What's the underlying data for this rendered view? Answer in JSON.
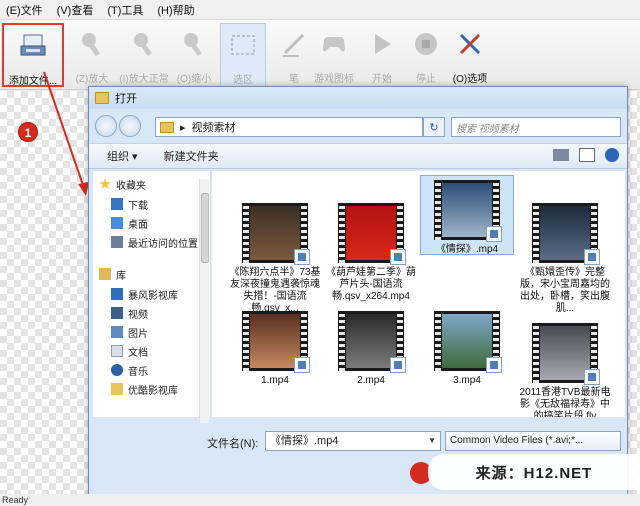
{
  "menubar": {
    "items": [
      "(E)文件",
      "(V)查看",
      "(T)工具",
      "(H)帮助"
    ]
  },
  "toolbar": {
    "add_file_label": "添加文件...",
    "zoom_in_label": "(Z)放大",
    "zoom_fit_label": "(I)放大正常",
    "zoom_out_label": "(O)缩小",
    "select_label": "选区",
    "pen_label": "笔",
    "controller_label": "游戏图标",
    "start_label": "开始",
    "stop_label": "停止",
    "options_label": "(O)选项"
  },
  "callout": {
    "number": "1"
  },
  "dialog": {
    "title": "打开",
    "address": "视频素材",
    "search_placeholder": "搜索 视频素材",
    "cmd_organize": "组织 ▾",
    "cmd_new_folder": "新建文件夹",
    "nav": {
      "favorites": "收藏夹",
      "downloads": "下载",
      "desktop": "桌面",
      "recent": "最近访问的位置",
      "library": "库",
      "baofeng": "暴风影视库",
      "videos": "视频",
      "pictures": "图片",
      "documents": "文档",
      "music": "音乐",
      "youku": "优酷影视库"
    },
    "files": [
      {
        "name": "《陈翔六点半》73基友深夜撞鬼遇袭惊魂失措！-国语流畅.qsv_x..."
      },
      {
        "name": "《葫芦娃第二季》葫芦片头-国语流畅.qsv_x264.mp4"
      },
      {
        "name": "《情探》.mp4"
      },
      {
        "name": "《甄嬛歪传》完整版，宋小宝周嘉均的出处，卧槽，笑出腹肌..."
      },
      {
        "name": "1.mp4"
      },
      {
        "name": "2.mp4"
      },
      {
        "name": "3.mp4"
      },
      {
        "name": "2011香港TVB最新电影《无敌福禄寿》中的搞笑片段.flv"
      }
    ],
    "filename_label": "文件名(N):",
    "filename_value": "《情探》.mp4",
    "filetype_value": "Common Video Files (*.avi;*..."
  },
  "status": {
    "text": "Ready"
  },
  "watermark": {
    "text": "来源：H12.NET"
  },
  "colors": {
    "accent": "#d52b1e",
    "selection": "#cde4f9",
    "dialog_bg": "#d9e6f5"
  }
}
